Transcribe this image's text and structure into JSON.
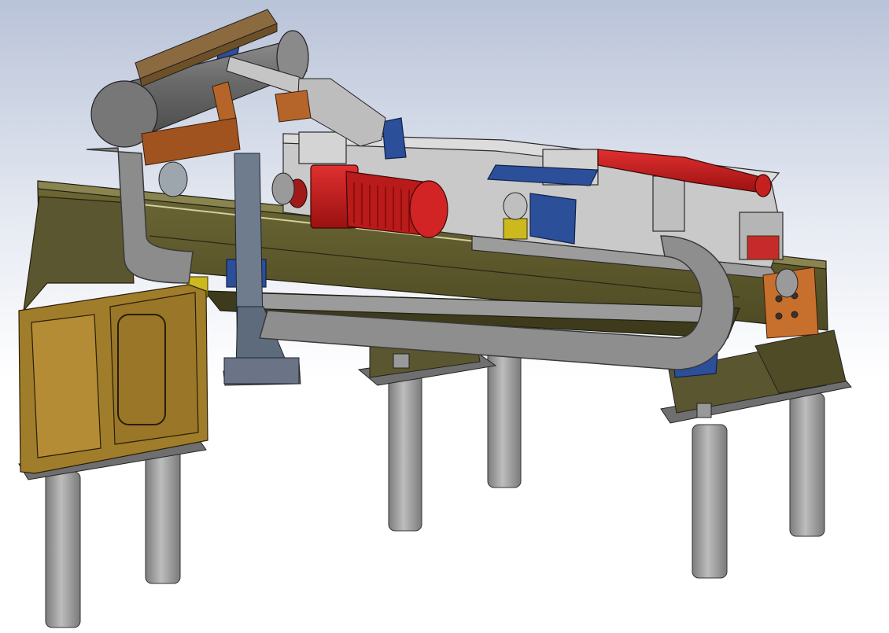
{
  "scene": {
    "kind": "cad-3d-model-view",
    "background": {
      "top": "#b9c3d8",
      "bottom": "#ffffff"
    },
    "components": [
      {
        "id": "main-frame-beam",
        "color": "#5f5a2c"
      },
      {
        "id": "left-pedestal",
        "color": "#a07d2a"
      },
      {
        "id": "support-legs",
        "color": "#a0a0a0"
      },
      {
        "id": "carriage-housing",
        "color": "#c9c9c9"
      },
      {
        "id": "drive-motor",
        "color": "#c41818"
      },
      {
        "id": "rear-motor",
        "color": "#c41818"
      },
      {
        "id": "cable-chain",
        "color": "#8c8c8c"
      },
      {
        "id": "cylinder-tank",
        "color": "#6e6e6e"
      },
      {
        "id": "blue-brackets",
        "color": "#2c4f9a"
      },
      {
        "id": "copper-blocks",
        "color": "#b5652a"
      },
      {
        "id": "sensor-boxes",
        "color": "#cbb91e"
      }
    ]
  }
}
